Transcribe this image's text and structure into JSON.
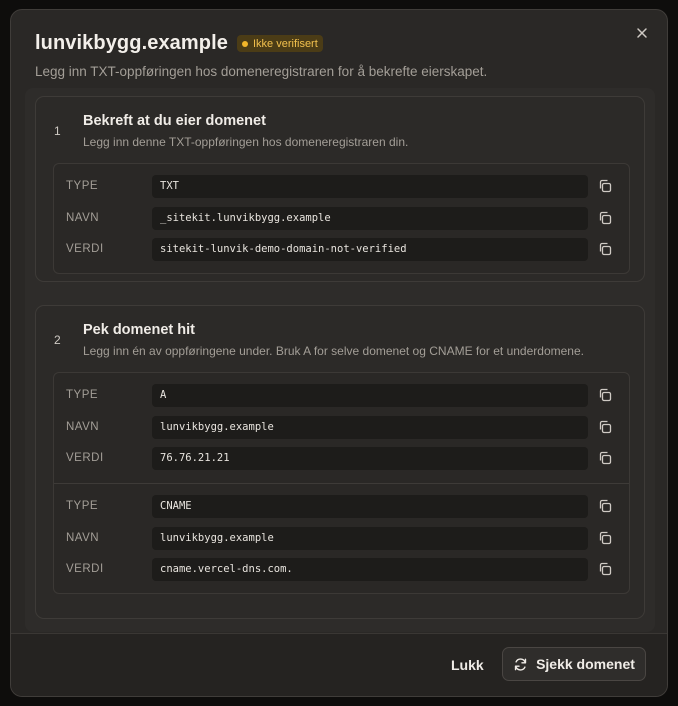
{
  "dialog": {
    "title": "lunvikbygg.example",
    "badge": "Ikke verifisert",
    "subtitle": "Legg inn TXT-oppføringen hos domeneregistraren for å bekrefte eierskapet.",
    "close_icon": "close-icon"
  },
  "section1": {
    "number": "1",
    "title": "Bekreft at du eier domenet",
    "desc": "Legg inn denne TXT-oppføringen hos domeneregistraren din.",
    "records": [
      {
        "label": "TYPE",
        "value": "TXT"
      },
      {
        "label": "NAVN",
        "value": "_sitekit.lunvikbygg.example"
      },
      {
        "label": "VERDI",
        "value": "sitekit-lunvik-demo-domain-not-verified"
      }
    ]
  },
  "section2": {
    "number": "2",
    "title": "Pek domenet hit",
    "desc": "Legg inn én av oppføringene under. Bruk A for selve domenet og CNAME for et underdomene.",
    "group_a": [
      {
        "label": "TYPE",
        "value": "A"
      },
      {
        "label": "NAVN",
        "value": "lunvikbygg.example"
      },
      {
        "label": "VERDI",
        "value": "76.76.21.21"
      }
    ],
    "group_cname": [
      {
        "label": "TYPE",
        "value": "CNAME"
      },
      {
        "label": "NAVN",
        "value": "lunvikbygg.example"
      },
      {
        "label": "VERDI",
        "value": "cname.vercel-dns.com."
      }
    ]
  },
  "footer": {
    "close_label": "Lukk",
    "check_label": "Sjekk domenet"
  },
  "colors": {
    "badge_bg": "#4b3c16",
    "badge_text": "#f2c14e",
    "dialog_bg": "#2a2826"
  }
}
